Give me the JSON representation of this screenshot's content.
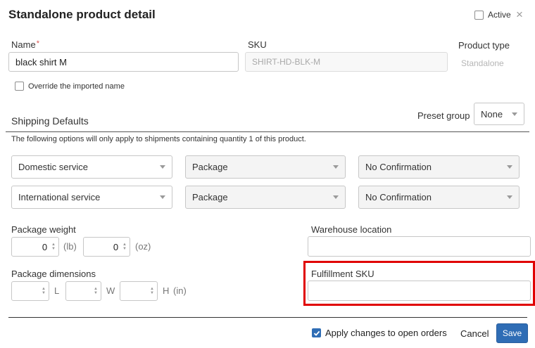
{
  "header": {
    "title": "Standalone product detail",
    "active_label": "Active",
    "close_icon": "×"
  },
  "fields": {
    "name_label": "Name",
    "name_required_mark": "*",
    "name_value": "black shirt M",
    "sku_label": "SKU",
    "sku_value": "SHIRT-HD-BLK-M",
    "product_type_label": "Product type",
    "product_type_value": "Standalone",
    "override_label": "Override the imported name"
  },
  "shipping": {
    "section_title": "Shipping Defaults",
    "preset_group_label": "Preset group",
    "preset_group_value": "None",
    "note": "The following options will only apply to shipments containing quantity 1 of this product.",
    "domestic_service": "Domestic service",
    "domestic_package": "Package",
    "domestic_confirmation": "No Confirmation",
    "international_service": "International service",
    "international_package": "Package",
    "international_confirmation": "No Confirmation"
  },
  "weight": {
    "label": "Package weight",
    "lb_value": "0",
    "lb_unit": "(lb)",
    "oz_value": "0",
    "oz_unit": "(oz)"
  },
  "dimensions": {
    "label": "Package dimensions",
    "l_unit": "L",
    "w_unit": "W",
    "h_unit": "H",
    "in_unit": "(in)"
  },
  "warehouse": {
    "label": "Warehouse location",
    "value": ""
  },
  "fulfillment": {
    "label": "Fulfillment SKU",
    "value": ""
  },
  "footer": {
    "apply_label": "Apply changes to open orders",
    "cancel_label": "Cancel",
    "save_label": "Save"
  },
  "colors": {
    "accent": "#2f6db5",
    "highlight": "#e00000"
  }
}
